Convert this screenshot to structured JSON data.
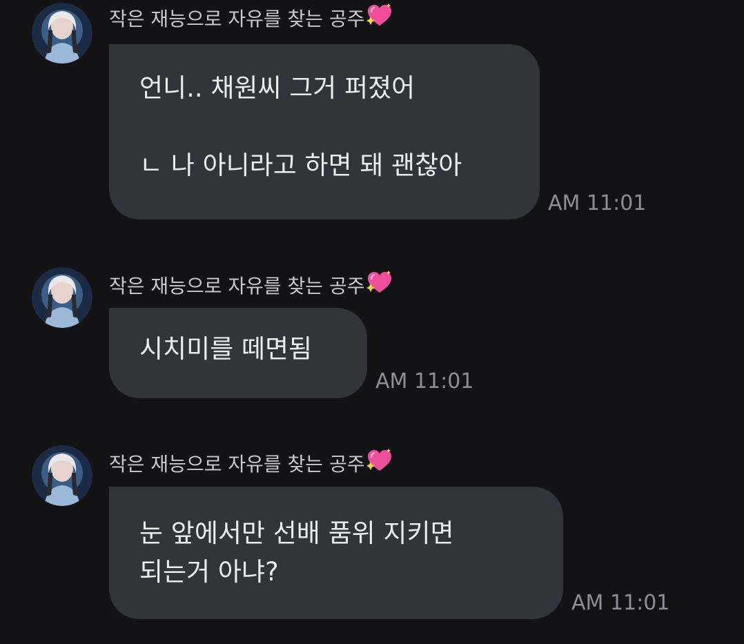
{
  "messages": [
    {
      "sender": "작은 재능으로 자유를 찾는 공주",
      "sender_icon": "sparkling-heart-icon",
      "text": "언니.. 채원씨 그거 퍼졌어\n\nㄴ 나 아니라고 하면 돼 괜찮아",
      "time": "AM 11:01"
    },
    {
      "sender": "작은 재능으로 자유를 찾는 공주",
      "sender_icon": "sparkling-heart-icon",
      "text": "시치미를 떼면됨",
      "time": "AM 11:01"
    },
    {
      "sender": "작은 재능으로 자유를 찾는 공주",
      "sender_icon": "sparkling-heart-icon",
      "text": "눈 앞에서만 선배 품위 지키면\n되는거 아냐?",
      "time": "AM 11:01"
    }
  ],
  "colors": {
    "background": "#131316",
    "bubble": "#333439",
    "bubble_text": "#ececee",
    "sender_text": "#c9c9cf",
    "time_text": "#8e8e94",
    "heart": "#f04e9b"
  }
}
